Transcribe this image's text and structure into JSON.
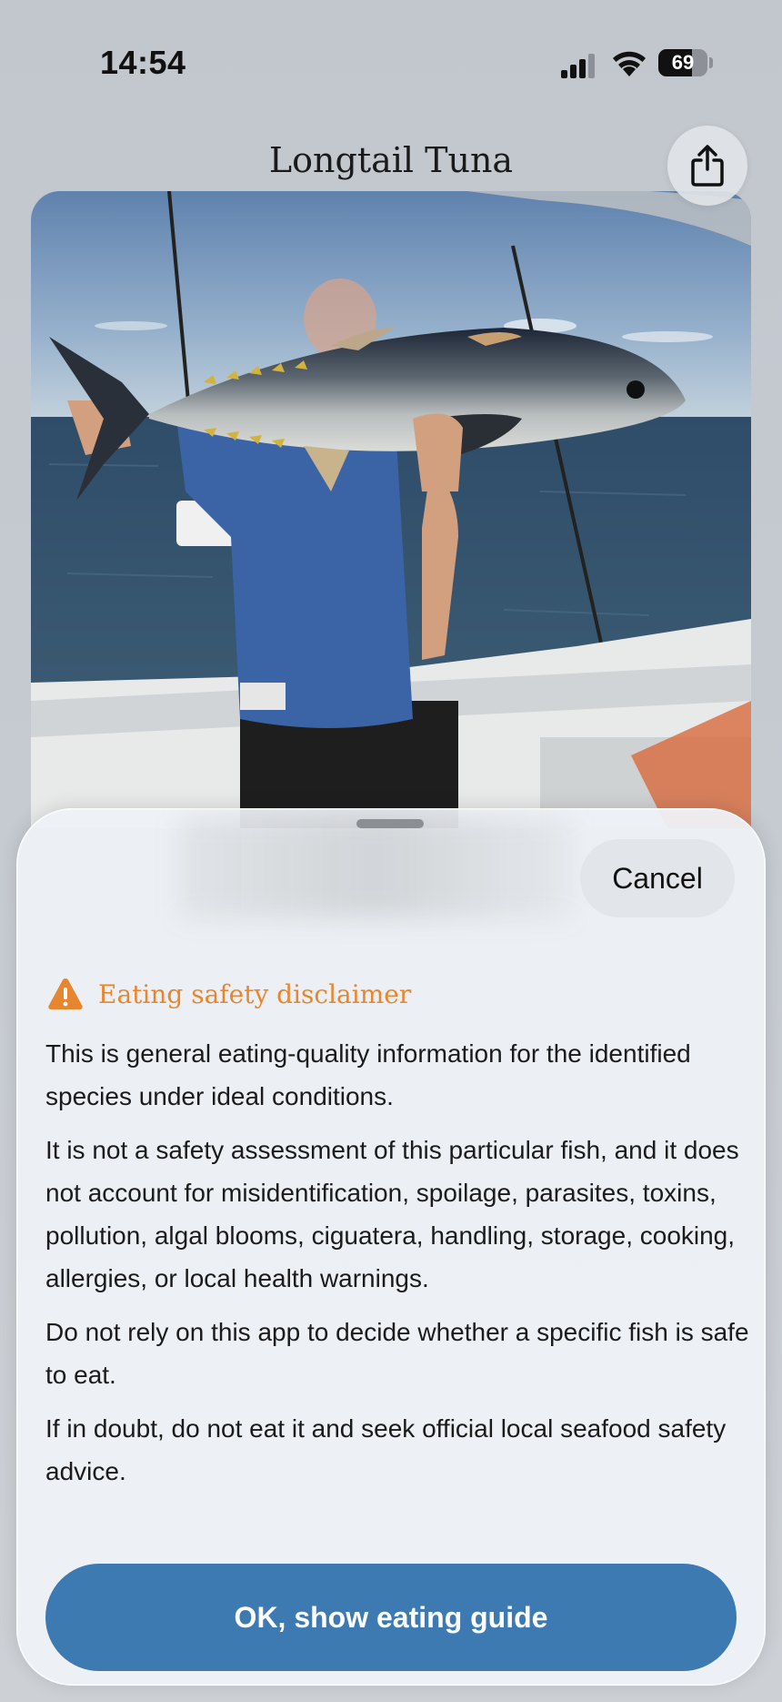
{
  "status_bar": {
    "time": "14:54",
    "battery_level": "69",
    "battery_fraction": 0.69
  },
  "header": {
    "title": "Longtail Tuna",
    "share_icon": "share-icon"
  },
  "photo": {
    "icon": "fish-photo"
  },
  "sheet": {
    "cancel_label": "Cancel",
    "disclaimer": {
      "icon": "warning-icon",
      "title": "Eating safety disclaimer",
      "paragraphs": [
        "This is general eating-quality information for the identified species under ideal conditions.",
        "It is not a safety assessment of this particular fish, and it does not account for misidentification, spoilage, parasites, toxins, pollution, algal blooms, ciguatera, handling, storage, cooking, allergies, or local health warnings.",
        "Do not rely on this app to decide whether a specific fish is safe to eat.",
        "If in doubt, do not eat it and seek official local seafood safety advice."
      ]
    },
    "primary_button_label": "OK, show eating guide"
  },
  "colors": {
    "accent_button": "#3c7ab1",
    "warning": "#e6862f"
  }
}
